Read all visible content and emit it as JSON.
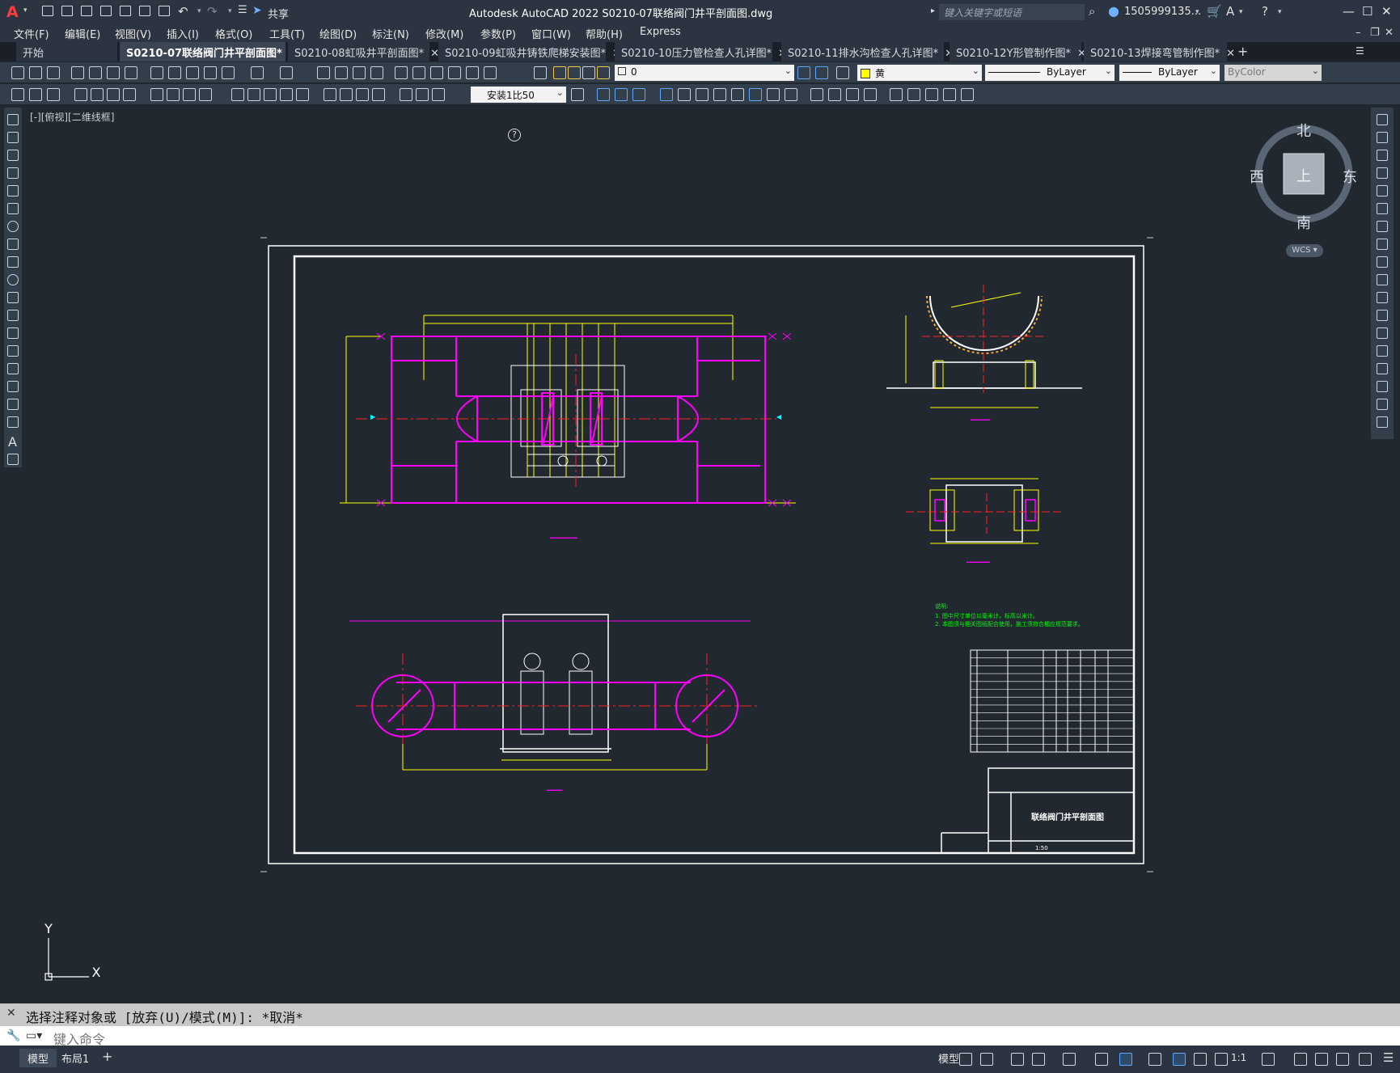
{
  "app": {
    "title": "Autodesk AutoCAD 2022    S0210-07联络阀门井平剖面图.dwg",
    "share_label": "共享",
    "search_placeholder": "键入关键字或短语",
    "user": "1505999135...",
    "logo_letter": "A"
  },
  "menu": [
    "文件(F)",
    "编辑(E)",
    "视图(V)",
    "插入(I)",
    "格式(O)",
    "工具(T)",
    "绘图(D)",
    "标注(N)",
    "修改(M)",
    "参数(P)",
    "窗口(W)",
    "帮助(H)",
    "Express"
  ],
  "tabs": [
    {
      "label": "开始",
      "active": false
    },
    {
      "label": "S0210-07联络阀门井平剖面图*",
      "active": true
    },
    {
      "label": "S0210-08虹吸井平剖面图*",
      "active": false
    },
    {
      "label": "S0210-09虹吸井铸铁爬梯安装图*",
      "active": false
    },
    {
      "label": "S0210-10压力管检查人孔详图*",
      "active": false
    },
    {
      "label": "S0210-11排水沟检查人孔详图*",
      "active": false
    },
    {
      "label": "S0210-12Y形管制作图*",
      "active": false
    },
    {
      "label": "S0210-13焊接弯管制作图*",
      "active": false
    }
  ],
  "toolbar": {
    "layer": "0",
    "color": "黄",
    "linetype": "ByLayer",
    "lineweight": "ByLayer",
    "plotstyle": "ByColor",
    "scale": "安装1比50"
  },
  "viewport": {
    "label": "[-][俯视][二维线框]",
    "compass": {
      "north": "北",
      "south": "南",
      "east": "东",
      "west": "西",
      "top": "上"
    },
    "wcs": "WCS",
    "ucs_x": "X",
    "ucs_y": "Y"
  },
  "drawing": {
    "title_block_name": "联络阀门井平剖面图",
    "scale_text": "1:50",
    "notes_heading": "说明:",
    "note1": "1. 图中尺寸单位以毫米计，标高以米计。",
    "note2": "2. 本图须与相关图纸配合使用，施工须符合相应规范要求。"
  },
  "command": {
    "history": "选择注释对象或 [放弃(U)/模式(M)]: *取消*",
    "placeholder": "键入命令"
  },
  "status": {
    "tabs": [
      "模型",
      "布局1"
    ],
    "model_label": "模型",
    "zoom": "1:1"
  },
  "colors": {
    "magenta": "#ff00ff",
    "yellow": "#ffff00",
    "red": "#ff2020",
    "green": "#00ff00",
    "white": "#ffffff"
  }
}
